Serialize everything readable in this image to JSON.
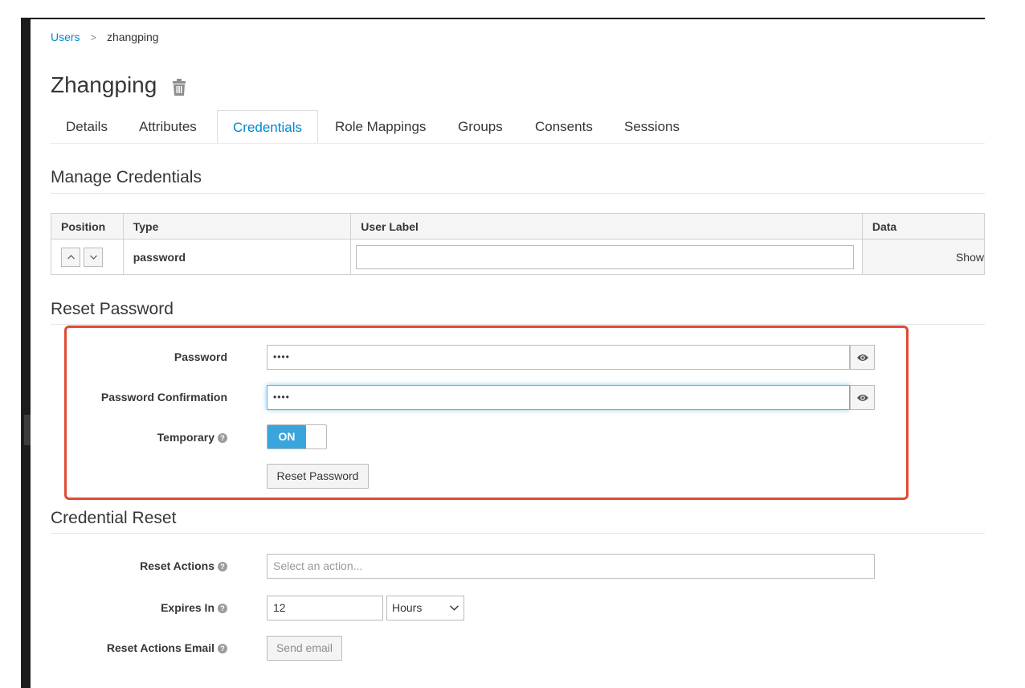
{
  "breadcrumb": {
    "parent": "Users",
    "separator": ">",
    "current": "zhangping"
  },
  "page": {
    "title": "Zhangping"
  },
  "tabs": [
    {
      "label": "Details"
    },
    {
      "label": "Attributes"
    },
    {
      "label": "Credentials",
      "active": true
    },
    {
      "label": "Role Mappings"
    },
    {
      "label": "Groups"
    },
    {
      "label": "Consents"
    },
    {
      "label": "Sessions"
    }
  ],
  "manage_credentials": {
    "title": "Manage Credentials",
    "columns": {
      "position": "Position",
      "type": "Type",
      "user_label": "User Label",
      "data": "Data"
    },
    "rows": [
      {
        "type": "password",
        "user_label": "",
        "data_action": "Show"
      }
    ]
  },
  "reset_password": {
    "title": "Reset Password",
    "password_label": "Password",
    "password_value": "••••",
    "confirmation_label": "Password Confirmation",
    "confirmation_value": "••••",
    "temporary_label": "Temporary",
    "temporary_state": "ON",
    "reset_button": "Reset Password"
  },
  "credential_reset": {
    "title": "Credential Reset",
    "reset_actions_label": "Reset Actions",
    "reset_actions_placeholder": "Select an action...",
    "expires_label": "Expires In",
    "expires_value": "12",
    "expires_unit": "Hours",
    "email_label": "Reset Actions Email",
    "send_email_button": "Send email"
  },
  "colors": {
    "accent": "#0088ce",
    "toggle_on": "#39a5dc",
    "highlight_box": "#e04a33"
  },
  "icons": {
    "delete": "trash-icon",
    "reveal": "eye-icon",
    "help": "question-circle-icon"
  }
}
